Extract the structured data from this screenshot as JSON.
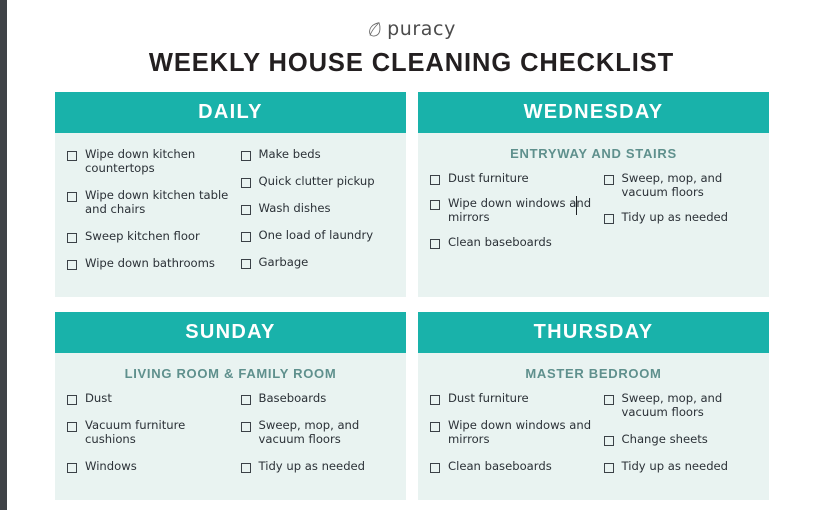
{
  "brand": {
    "name": "puracy",
    "icon": "leaf-icon"
  },
  "document": {
    "title": "WEEKLY HOUSE CLEANING CHECKLIST"
  },
  "colors": {
    "header_teal": "#19b2aa",
    "card_body": "#e9f3f1",
    "subheading": "#5f908d",
    "title_text": "#231f20",
    "task_text": "#2b3137",
    "chrome_strip": "#3f4347"
  },
  "cards": [
    {
      "id": "daily",
      "title": "DAILY",
      "subheading": "",
      "columns": [
        {
          "tasks": [
            "Wipe down kitchen countertops",
            "Wipe down kitchen table and chairs",
            "Sweep kitchen floor",
            "Wipe down bathrooms"
          ]
        },
        {
          "tasks": [
            "Make beds",
            "Quick clutter pickup",
            "Wash dishes",
            "One load of laundry",
            "Garbage"
          ]
        }
      ]
    },
    {
      "id": "wednesday",
      "title": "WEDNESDAY",
      "subheading": "ENTRYWAY AND STAIRS",
      "columns": [
        {
          "tasks": [
            "Dust furniture",
            "Wipe down windows and mirrors",
            "Clean baseboards"
          ]
        },
        {
          "tasks": [
            "Sweep, mop, and vacuum floors",
            "Tidy up as needed"
          ]
        }
      ]
    },
    {
      "id": "sunday",
      "title": "SUNDAY",
      "subheading": "LIVING ROOM & FAMILY ROOM",
      "columns": [
        {
          "tasks": [
            "Dust",
            "Vacuum furniture cushions",
            "Windows"
          ]
        },
        {
          "tasks": [
            "Baseboards",
            "Sweep, mop, and vacuum floors",
            "Tidy up as needed"
          ]
        }
      ]
    },
    {
      "id": "thursday",
      "title": "THURSDAY",
      "subheading": "MASTER BEDROOM",
      "columns": [
        {
          "tasks": [
            "Dust furniture",
            "Wipe down windows and mirrors",
            "Clean baseboards"
          ]
        },
        {
          "tasks": [
            "Sweep, mop, and vacuum floors",
            "Change sheets",
            "Tidy up as needed"
          ]
        }
      ]
    }
  ]
}
